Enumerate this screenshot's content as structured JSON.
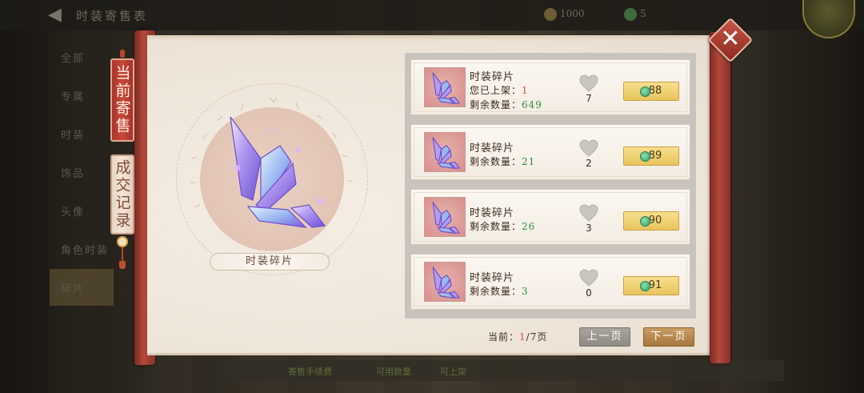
{
  "background": {
    "title": "时装寄售表",
    "side_tabs": [
      "全部",
      "专属",
      "时装",
      "饰品",
      "头像",
      "角色时装",
      "碎片"
    ],
    "bottom_bar": [
      "寄售手续费",
      "可用数量",
      "可上架"
    ],
    "resource_values": [
      "1000",
      "5"
    ]
  },
  "tabs": {
    "current_sale": "当前寄售",
    "trade_record": "成交记录"
  },
  "showcase": {
    "item_name": "时装碎片"
  },
  "listings": [
    {
      "title": "时装碎片",
      "listed_label": "您已上架：",
      "listed_value": "1",
      "remaining_label": "剩余数量：",
      "remaining_value": "649",
      "likes": "7",
      "price": "88"
    },
    {
      "title": "时装碎片",
      "remaining_label": "剩余数量：",
      "remaining_value": "21",
      "likes": "2",
      "price": "89"
    },
    {
      "title": "时装碎片",
      "remaining_label": "剩余数量：",
      "remaining_value": "26",
      "likes": "3",
      "price": "90"
    },
    {
      "title": "时装碎片",
      "remaining_label": "剩余数量：",
      "remaining_value": "3",
      "likes": "0",
      "price": "91"
    }
  ],
  "pager": {
    "label": "当前：",
    "current": "1",
    "total": "/7页",
    "prev": "上一页",
    "next": "下一页"
  },
  "icons": {
    "close": "close-icon",
    "like": "heart-icon",
    "currency": "jade-coin-icon",
    "item": "crystal-wing-icon"
  },
  "colors": {
    "active_tab": "#c9473b",
    "price_button": "#e9c45d",
    "next_button": "#a6773e",
    "remaining_value": "#2f8f3c",
    "listed_value": "#d2523b"
  }
}
